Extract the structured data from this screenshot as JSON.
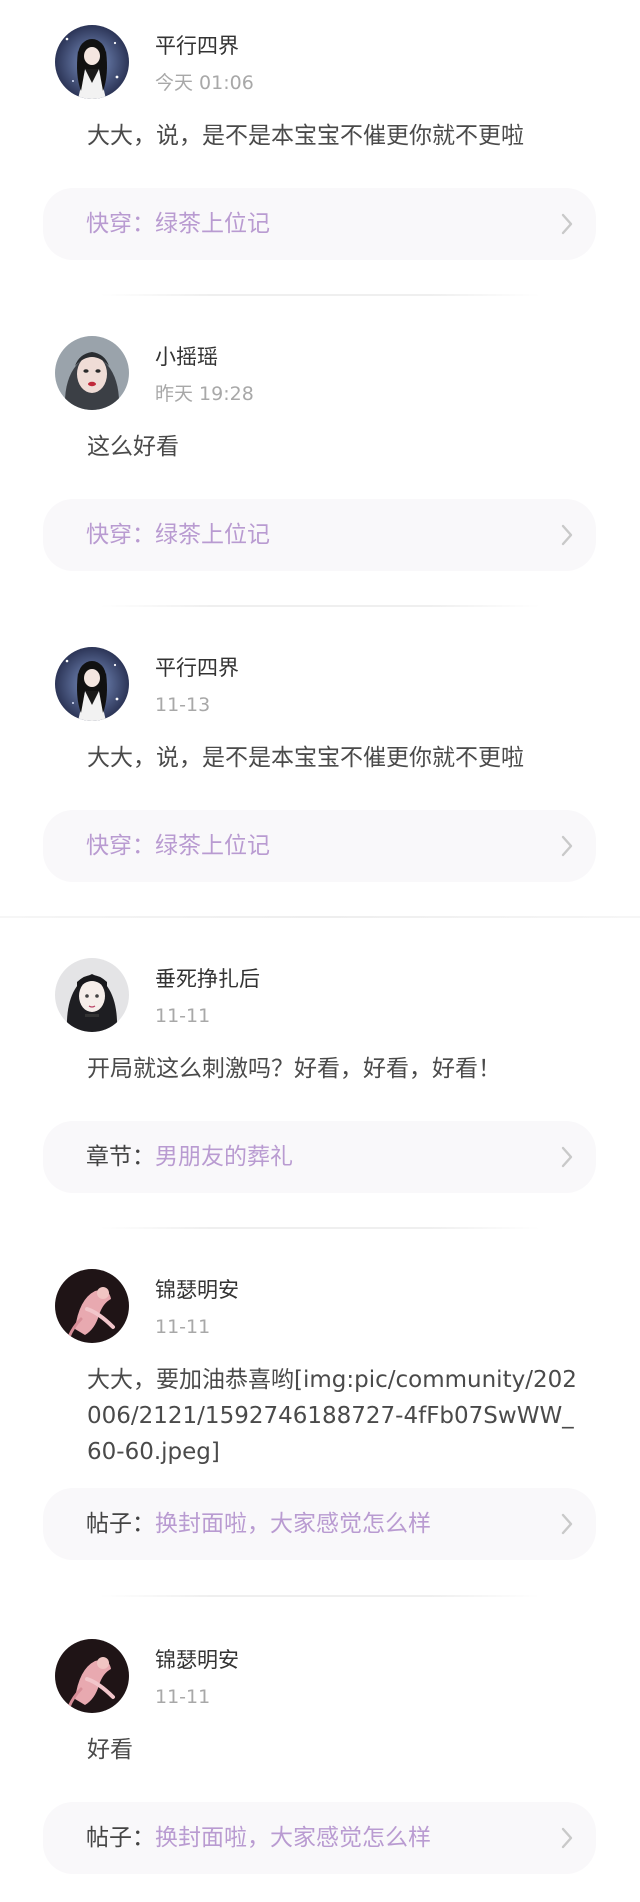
{
  "comments": [
    {
      "username": "平行四界",
      "time": "今天 01:06",
      "content": "大大，说，是不是本宝宝不催更你就不更啦",
      "source_prefix": "快穿：",
      "source_title": "绿茶上位记",
      "avatar": "anime-girl-starry-avatar"
    },
    {
      "username": "小摇瑶",
      "time": "昨天 19:28",
      "content": "这么好看",
      "source_prefix": "快穿：",
      "source_title": "绿茶上位记",
      "avatar": "girl-portrait-avatar"
    },
    {
      "username": "平行四界",
      "time": "11-13",
      "content": "大大，说，是不是本宝宝不催更你就不更啦",
      "source_prefix": "快穿：",
      "source_title": "绿茶上位记",
      "avatar": "anime-girl-starry-avatar"
    },
    {
      "username": "垂死挣扎后",
      "time": "11-11",
      "content": "开局就这么刺激吗？好看，好看，好看！",
      "source_prefix": "章节：",
      "source_title": "男朋友的葬礼",
      "avatar": "dark-haired-character-avatar"
    },
    {
      "username": "锦瑟明安",
      "time": "11-11",
      "content": "大大，要加油恭喜哟[img:pic/community/202006/2121/1592746188727-4fFb07SwWW_60-60.jpeg]",
      "source_prefix": "帖子：",
      "source_title": "换封面啦，大家感觉怎么样",
      "avatar": "pink-dancer-avatar"
    },
    {
      "username": "锦瑟明安",
      "time": "11-11",
      "content": "好看",
      "source_prefix": "帖子：",
      "source_title": "换封面啦，大家感觉怎么样",
      "avatar": "pink-dancer-avatar"
    }
  ],
  "colors": {
    "accent": "#b99bd1",
    "card_bg": "#f9f8fa",
    "time": "#a8a8a8",
    "text": "#4a4a4a"
  }
}
